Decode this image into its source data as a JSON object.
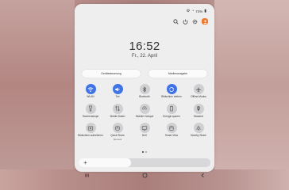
{
  "status_bar": {
    "battery": "74%"
  },
  "header_icons": [
    "search-icon",
    "power-icon",
    "gear-icon",
    "user-avatar-icon"
  ],
  "clock": {
    "time": "16:52",
    "date": "Fr., 22. April"
  },
  "quick_buttons": [
    {
      "label": "Gerätesteuerung"
    },
    {
      "label": "Medienausgabe"
    }
  ],
  "tiles": [
    {
      "label": "WLAN",
      "sub": "",
      "icon": "wifi-icon",
      "active": true
    },
    {
      "label": "Ton",
      "sub": "",
      "icon": "sound-icon",
      "active": true
    },
    {
      "label": "Bluetooth",
      "sub": "",
      "icon": "bluetooth-icon",
      "active": false
    },
    {
      "label": "Bildschirm drehen",
      "sub": "",
      "icon": "rotate-icon",
      "active": true
    },
    {
      "label": "Offline-Modus",
      "sub": "",
      "icon": "airplane-icon",
      "active": false
    },
    {
      "label": "Taschenlampe",
      "sub": "",
      "icon": "flashlight-icon",
      "active": false
    },
    {
      "label": "Mobile Daten",
      "sub": "",
      "icon": "mobile-data-icon",
      "active": false
    },
    {
      "label": "Mobiler Hotspot",
      "sub": "",
      "icon": "hotspot-icon",
      "active": false
    },
    {
      "label": "Energie sparen",
      "sub": "",
      "icon": "battery-saver-icon",
      "active": false
    },
    {
      "label": "Standort",
      "sub": "",
      "icon": "location-icon",
      "active": false
    },
    {
      "label": "Bildschirm aufnehmen",
      "sub": "",
      "icon": "screen-record-icon",
      "active": false
    },
    {
      "label": "Quick Share",
      "sub": "Niemand",
      "icon": "quick-share-icon",
      "active": false
    },
    {
      "label": "DeX",
      "sub": "",
      "icon": "dex-icon",
      "active": false
    },
    {
      "label": "Smart View",
      "sub": "",
      "icon": "smart-view-icon",
      "active": false
    },
    {
      "label": "Nearby Share",
      "sub": "",
      "icon": "nearby-share-icon",
      "active": false
    }
  ],
  "pager": {
    "pages": 2,
    "current": 1
  },
  "brightness": {
    "level": 0.4
  },
  "nav": [
    "recent-apps-icon",
    "home-icon",
    "back-icon"
  ]
}
